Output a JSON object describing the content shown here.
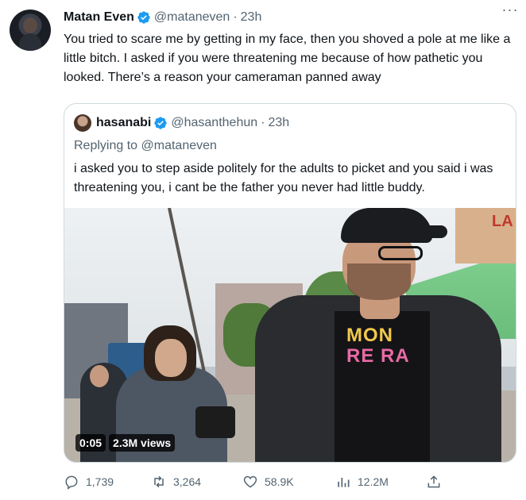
{
  "author": {
    "name": "Matan Even",
    "handle": "@mataneven",
    "time": "23h",
    "more_label": "···"
  },
  "tweet_text": "You tried to scare me by getting in my face, then you shoved a pole at me like a little bitch. I asked if you were threatening me because of how pathetic you looked. There’s a reason your cameraman panned away",
  "quoted": {
    "name": "hasanabi",
    "handle": "@hasanthehun",
    "time": "23h",
    "replying_to_prefix": "Replying to ",
    "replying_to_handle": "@mataneven",
    "text": "i asked you to step aside politely for the adults to picket and you said i was threatening you, i cant be the father you never had little buddy.",
    "video": {
      "duration": "0:05",
      "views": "2.3M views",
      "shirt_text_1": "MON",
      "shirt_text_2": "RE RA",
      "sign_text": "LA"
    }
  },
  "actions": {
    "replies": "1,739",
    "retweets": "3,264",
    "likes": "58.9K",
    "views": "12.2M"
  },
  "colors": {
    "verified": "#1d9bf0",
    "secondary_text": "#536471",
    "primary_text": "#0f1419",
    "border": "#cfd9de"
  },
  "icons": {
    "reply": "reply-icon",
    "retweet": "retweet-icon",
    "like": "heart-icon",
    "views": "analytics-icon",
    "share": "share-icon"
  }
}
